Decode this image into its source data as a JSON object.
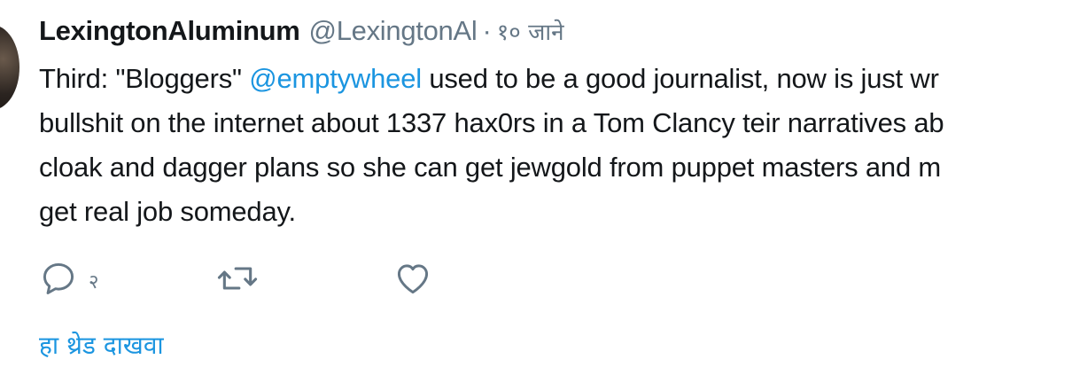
{
  "tweet": {
    "display_name": "LexingtonAluminum",
    "handle": "@LexingtonAl",
    "separator": "·",
    "time": "१० जाने",
    "text_lines": [
      [
        "Third: \"Bloggers\" ",
        "@emptywheel",
        " used to be a good journalist, now is just wr"
      ],
      "bullshit on the internet about 1337 hax0rs in a Tom Clancy teir narratives ab",
      "cloak and dagger plans so she can get jewgold from puppet masters and m",
      "get real job someday."
    ],
    "reply_count": "२",
    "show_thread": "हा थ्रेड दाखवा"
  },
  "icons": {
    "reply": "reply-icon",
    "retweet": "retweet-icon",
    "like": "heart-icon"
  },
  "colors": {
    "link": "#1b95e0",
    "secondary": "#657786",
    "text": "#14171a"
  }
}
